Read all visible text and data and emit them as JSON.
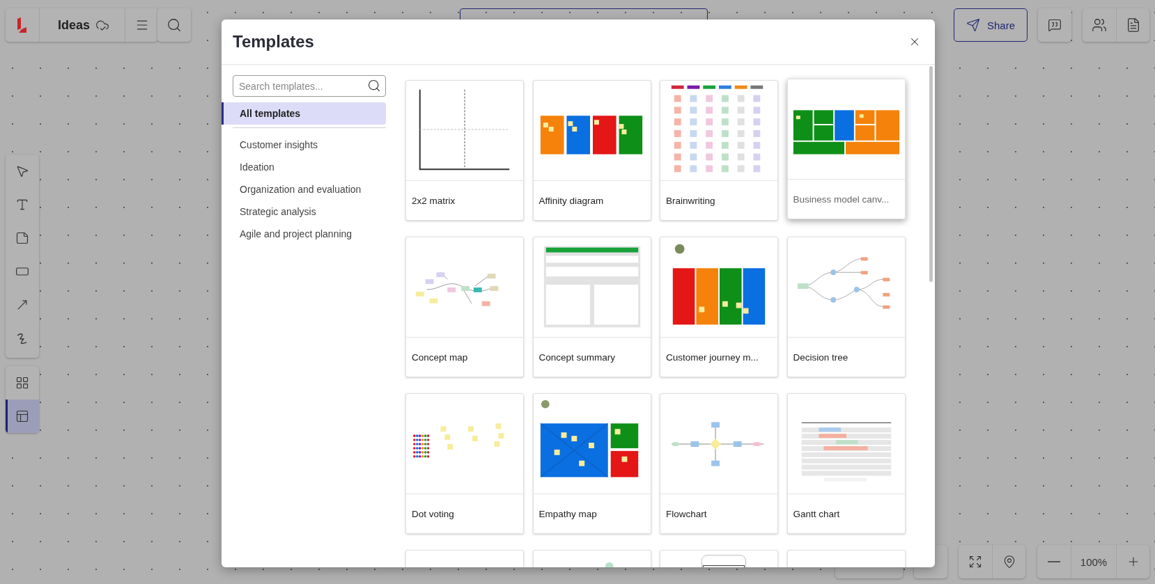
{
  "app": {
    "title": "Ideas"
  },
  "share": {
    "label": "Share"
  },
  "left_tools": [
    {
      "kind": "select"
    },
    {
      "kind": "text"
    },
    {
      "kind": "sticky"
    },
    {
      "kind": "shape"
    },
    {
      "kind": "arrow"
    },
    {
      "kind": "pen"
    }
  ],
  "panel_tools": [
    {
      "kind": "grid",
      "selected": false
    },
    {
      "kind": "templates",
      "selected": true
    }
  ],
  "zoom": {
    "reading": "100%"
  },
  "modal": {
    "title": "Templates",
    "search": {
      "placeholder": "Search templates..."
    },
    "categories": [
      {
        "label": "All templates",
        "selected": true
      },
      {
        "label": "Customer insights",
        "selected": false
      },
      {
        "label": "Ideation",
        "selected": false
      },
      {
        "label": "Organization and evaluation",
        "selected": false
      },
      {
        "label": "Strategic analysis",
        "selected": false
      },
      {
        "label": "Agile and project planning",
        "selected": false
      }
    ],
    "templates": [
      {
        "label": "2x2 matrix",
        "kind": "matrix",
        "highlighted": false
      },
      {
        "label": "Affinity diagram",
        "kind": "affinity",
        "highlighted": false
      },
      {
        "label": "Brainwriting",
        "kind": "brainwriting",
        "highlighted": false
      },
      {
        "label": "Business model canv...",
        "kind": "canvas",
        "highlighted": true
      },
      {
        "label": "Concept map",
        "kind": "conceptmap",
        "highlighted": false
      },
      {
        "label": "Concept summary",
        "kind": "summary",
        "highlighted": false
      },
      {
        "label": "Customer journey m...",
        "kind": "journey",
        "highlighted": false
      },
      {
        "label": "Decision tree",
        "kind": "tree",
        "highlighted": false
      },
      {
        "label": "Dot voting",
        "kind": "dots",
        "highlighted": false
      },
      {
        "label": "Empathy map",
        "kind": "empathy",
        "highlighted": false
      },
      {
        "label": "Flowchart",
        "kind": "flowchart",
        "highlighted": false
      },
      {
        "label": "Gantt chart",
        "kind": "gantt",
        "highlighted": false
      },
      {
        "kind": "blank",
        "highlighted": false
      },
      {
        "kind": "circle",
        "highlighted": false
      },
      {
        "kind": "phone",
        "highlighted": false
      },
      {
        "kind": "blank",
        "highlighted": false
      }
    ]
  }
}
